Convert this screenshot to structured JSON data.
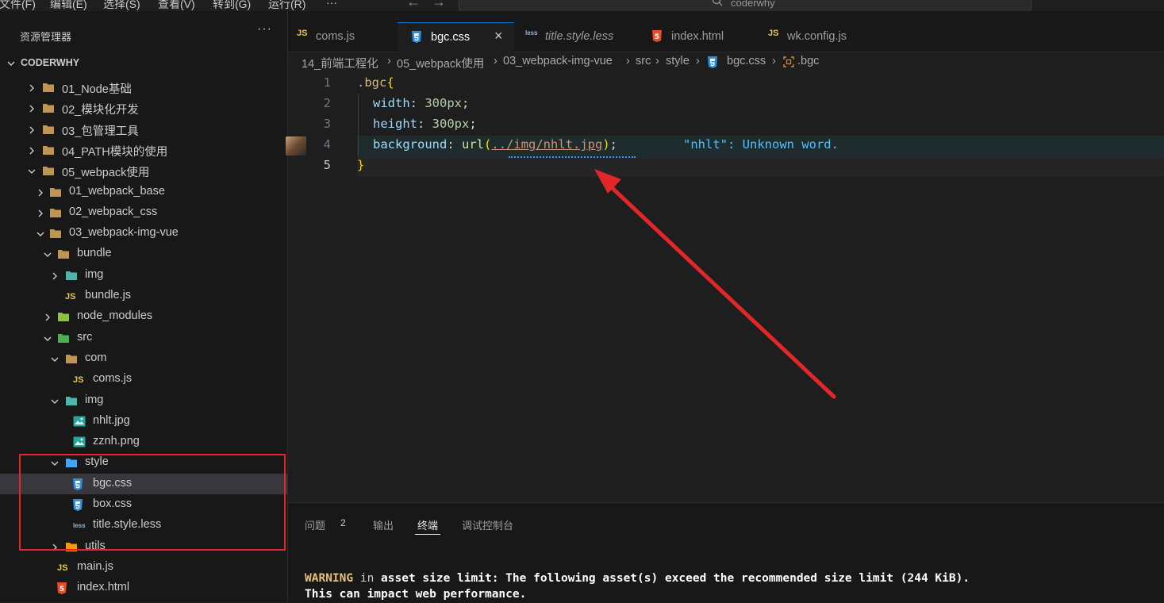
{
  "menu": {
    "items": [
      "文件(F)",
      "编辑(E)",
      "选择(S)",
      "查看(V)",
      "转到(G)",
      "运行(R)",
      "···"
    ],
    "back_arrow": "←",
    "forward_arrow": "→",
    "search_text": "coderwhy",
    "search_icon": "search-icon"
  },
  "sidebar": {
    "title": "资源管理器",
    "more": "···",
    "root": "CODERWHY",
    "tree": [
      {
        "label": "01_Node基础",
        "icon": "folder-icon",
        "chevron": "right"
      },
      {
        "label": "02_模块化开发",
        "icon": "folder-icon",
        "chevron": "right"
      },
      {
        "label": "03_包管理工具",
        "icon": "folder-icon",
        "chevron": "right"
      },
      {
        "label": "04_PATH模块的使用",
        "icon": "folder-icon",
        "chevron": "right"
      },
      {
        "label": "05_webpack使用",
        "icon": "folder-open-icon",
        "chevron": "down"
      },
      {
        "label": "01_webpack_base",
        "icon": "folder-icon",
        "chevron": "right"
      },
      {
        "label": "02_webpack_css",
        "icon": "folder-icon",
        "chevron": "right"
      },
      {
        "label": "03_webpack-img-vue",
        "icon": "folder-open-icon",
        "chevron": "down"
      },
      {
        "label": "bundle",
        "icon": "folder-open-icon",
        "chevron": "down"
      },
      {
        "label": "img",
        "icon": "image-folder-icon",
        "chevron": "right"
      },
      {
        "label": "bundle.js",
        "icon": "js-file-icon",
        "badge": "JS"
      },
      {
        "label": "node_modules",
        "icon": "node-modules-folder-icon",
        "chevron": "right"
      },
      {
        "label": "src",
        "icon": "src-folder-icon",
        "chevron": "down"
      },
      {
        "label": "com",
        "icon": "folder-open-icon",
        "chevron": "down"
      },
      {
        "label": "coms.js",
        "icon": "js-file-icon",
        "badge": "JS"
      },
      {
        "label": "img",
        "icon": "image-folder-open-icon",
        "chevron": "down"
      },
      {
        "label": "nhlt.jpg",
        "icon": "image-file-icon"
      },
      {
        "label": "zznh.png",
        "icon": "image-file-icon"
      },
      {
        "label": "style",
        "icon": "style-folder-open-icon",
        "chevron": "down"
      },
      {
        "label": "bgc.css",
        "icon": "css-file-icon",
        "selected": true
      },
      {
        "label": "box.css",
        "icon": "css-file-icon"
      },
      {
        "label": "title.style.less",
        "icon": "less-file-icon",
        "badge": "less"
      },
      {
        "label": "utils",
        "icon": "utils-folder-icon",
        "chevron": "right"
      },
      {
        "label": "main.js",
        "icon": "js-file-icon",
        "badge": "JS"
      },
      {
        "label": "index.html",
        "icon": "html-file-icon"
      }
    ]
  },
  "tabs": [
    {
      "label": "coms.js",
      "icon": "js-file-icon",
      "badge": "JS"
    },
    {
      "label": "bgc.css",
      "icon": "css-file-icon",
      "active": true,
      "close": "×"
    },
    {
      "label": "title.style.less",
      "icon": "less-file-icon",
      "badge": "less"
    },
    {
      "label": "index.html",
      "icon": "html-file-icon"
    },
    {
      "label": "wk.config.js",
      "icon": "js-file-icon",
      "badge": "JS"
    }
  ],
  "breadcrumb": [
    "14_前端工程化",
    "05_webpack使用",
    "03_webpack-img-vue",
    "src",
    "style",
    "bgc.css",
    ".bgc"
  ],
  "editor": {
    "line_numbers": [
      "1",
      "2",
      "3",
      "4",
      "5"
    ],
    "current_line": 4,
    "code": {
      "l1_selector": ".bgc",
      "l1_brace": "{",
      "l2_prop": "width",
      "l2_colon": ": ",
      "l2_value": "300px",
      "l2_semi": ";",
      "l3_prop": "height",
      "l3_colon": ": ",
      "l3_value": "300px",
      "l3_semi": ";",
      "l4_prop": "background",
      "l4_colon": ": ",
      "l4_fn": "url",
      "l4_open": "(",
      "l4_path": "../img/nhlt.jpg",
      "l4_close": ")",
      "l4_semi": ";",
      "l5_brace": "}"
    },
    "diagnostic": "\"nhlt\": Unknown word.",
    "annotation_color": "#e2262a"
  },
  "panel": {
    "tabs": [
      "问题",
      "输出",
      "终端",
      "调试控制台"
    ],
    "active_tab": "终端",
    "problems_count": "2",
    "terminal": {
      "warning_word": "WARNING",
      "in_word": " in ",
      "line1_rest": "asset size limit: The following asset(s) exceed the recommended size limit (244 KiB).",
      "line2": "This can impact web performance."
    }
  }
}
